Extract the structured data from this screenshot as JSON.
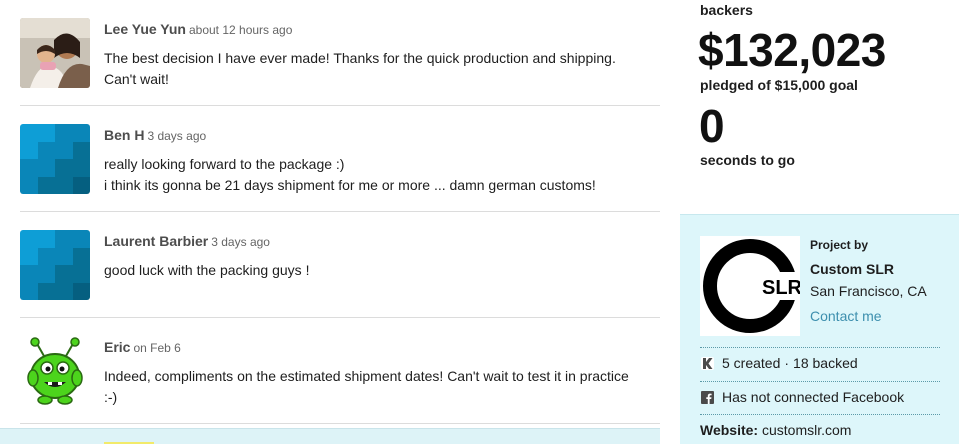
{
  "comments": [
    {
      "author": "Lee Yue Yun",
      "time": "about 12 hours ago",
      "lines": [
        "The best decision I have ever made! Thanks for the quick production and shipping.",
        "Can't wait!"
      ],
      "avatar": "photo"
    },
    {
      "author": "Ben H",
      "time": "3 days ago",
      "lines": [
        "really looking forward to the package :)",
        "i think its gonna be 21 days shipment for me or more ... damn german customs!"
      ],
      "avatar": "tile"
    },
    {
      "author": "Laurent Barbier",
      "time": "3 days ago",
      "lines": [
        "good luck with the packing guys !"
      ],
      "avatar": "tile"
    },
    {
      "author": "Eric",
      "time": "on Feb 6",
      "lines": [
        "Indeed, compliments on the estimated shipment dates! Can't wait to test it in practice",
        ":-)"
      ],
      "avatar": "alien"
    }
  ],
  "stats": {
    "backers_label": "backers",
    "pledged_amount": "$132,023",
    "pledged_label": "pledged of $15,000 goal",
    "seconds_value": "0",
    "seconds_label": "seconds to go"
  },
  "creator": {
    "by_label": "Project by",
    "name": "Custom SLR",
    "location": "San Francisco, CA",
    "contact_label": "Contact me",
    "logo_text": "SLR",
    "created": "5 created",
    "backed": "18 backed",
    "facebook_text": "Has not connected Facebook",
    "website_label": "Website:",
    "website_value": "customslr.com",
    "icons": {
      "kickstarter": "kickstarter-icon",
      "facebook": "facebook-icon"
    }
  },
  "colors": {
    "accent_link": "#3d8fae",
    "panel_bg": "#ddf6fa",
    "tile_palette": [
      "#0e9ed6",
      "#0a86b8",
      "#077095",
      "#055f80"
    ]
  }
}
